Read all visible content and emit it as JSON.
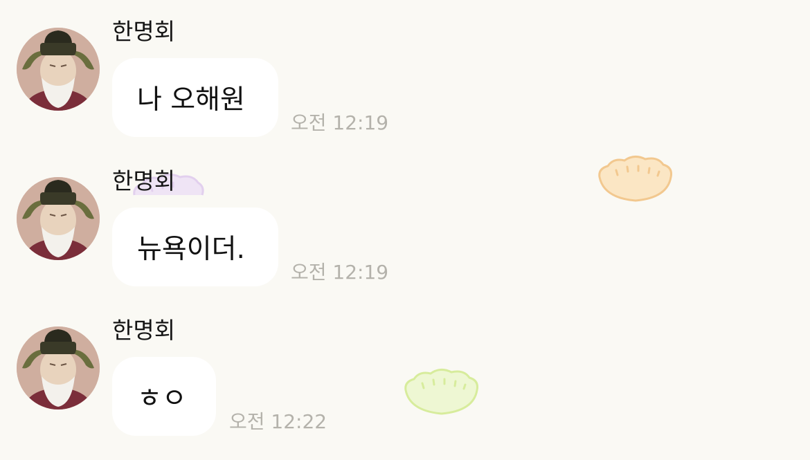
{
  "chat": {
    "messages": [
      {
        "sender": "한명회",
        "text": "나 오해원",
        "time": "오전 12:19"
      },
      {
        "sender": "한명회",
        "text": "뉴욕이더.",
        "time": "오전 12:19"
      },
      {
        "sender": "한명회",
        "text": "ㅎㅇ",
        "time": "오전 12:22"
      }
    ]
  },
  "colors": {
    "background": "#faf9f4",
    "bubble": "#ffffff",
    "timestamp": "#b4b2ab",
    "dumpling_orange": "#f4c98a",
    "dumpling_purple": "#e6d6f2",
    "dumpling_green": "#d7ef9e"
  },
  "icons": {
    "avatar": "scholar-portrait",
    "decorations": [
      "dumpling-icon",
      "dumpling-icon",
      "dumpling-icon"
    ]
  }
}
